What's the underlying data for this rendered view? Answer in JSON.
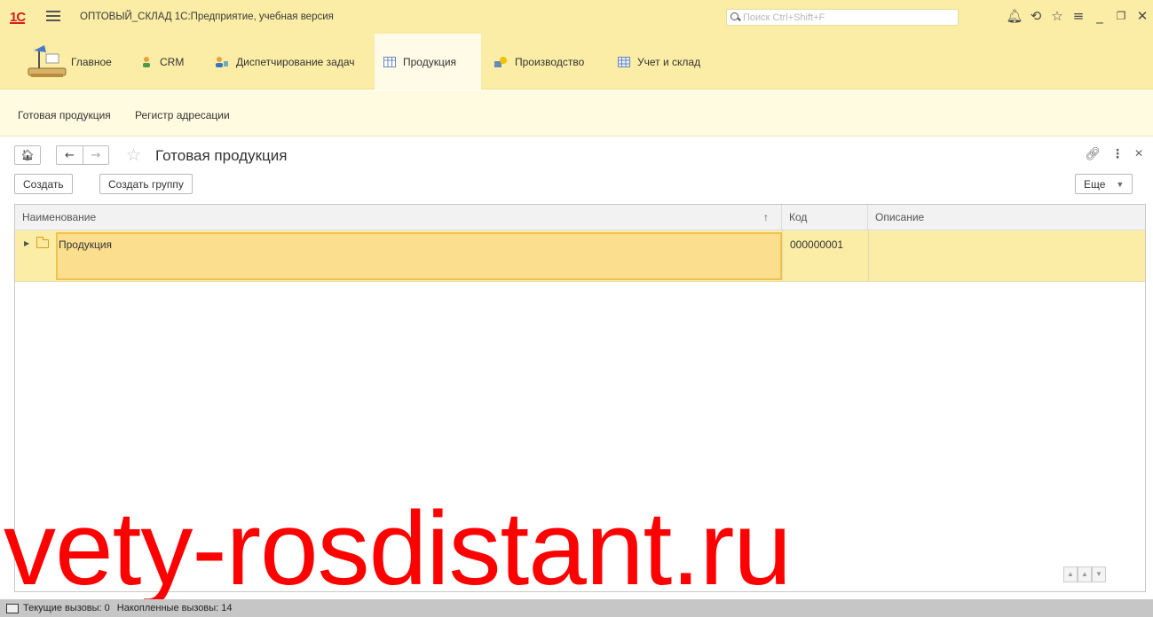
{
  "app": {
    "logo": "1С",
    "title": "ОПТОВЫЙ_СКЛАД 1С:Предприятие, учебная версия",
    "search_placeholder": "Поиск Ctrl+Shift+F"
  },
  "sections": [
    {
      "label": "Главное"
    },
    {
      "label": "CRM"
    },
    {
      "label": "Диспетчирование задач"
    },
    {
      "label": "Продукция",
      "active": true
    },
    {
      "label": "Производство"
    },
    {
      "label": "Учет и склад"
    }
  ],
  "subsystem_links": [
    "Готовая продукция",
    "Регистр адресации"
  ],
  "form": {
    "title": "Готовая продукция",
    "create_label": "Создать",
    "create_group_label": "Создать группу",
    "more_label": "Еще"
  },
  "table": {
    "columns": [
      {
        "label": "Наименование",
        "sort": "↑"
      },
      {
        "label": "Код"
      },
      {
        "label": "Описание"
      }
    ],
    "rows": [
      {
        "name": "Продукция",
        "code": "000000001",
        "description": ""
      }
    ]
  },
  "watermark": "vety-rosdistant.ru",
  "status": {
    "current_calls": "Текущие вызовы: 0",
    "accumulated_calls": "Накопленные вызовы: 14"
  },
  "colors": {
    "accent_yellow": "#fbeda5",
    "selection": "#fbdf8f",
    "watermark": "#ff0000"
  }
}
